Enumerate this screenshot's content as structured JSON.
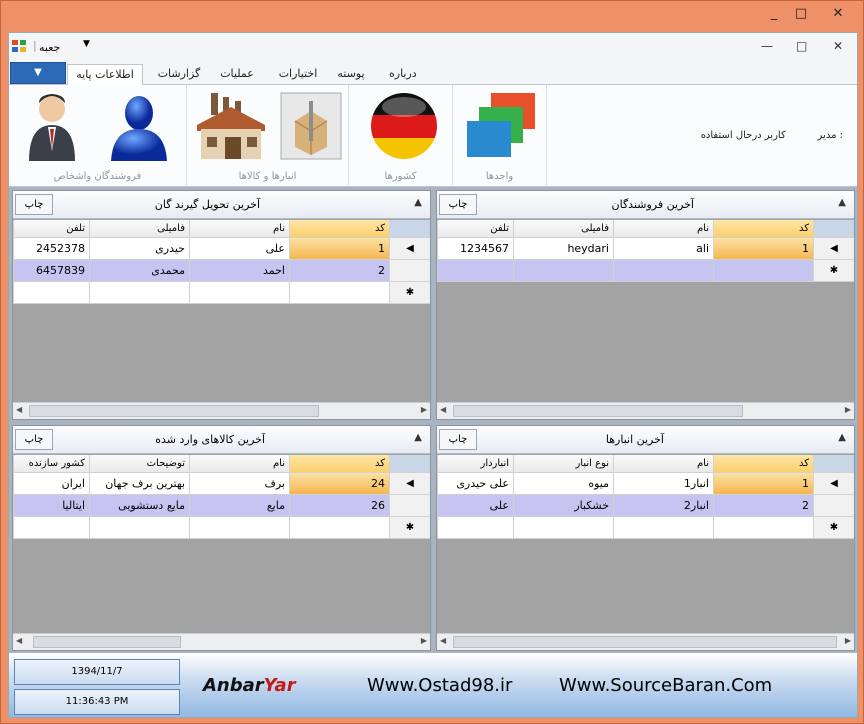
{
  "window": {
    "minimize": "_",
    "maximize": "□",
    "close": "✕"
  },
  "qat": {
    "title": "جعبه",
    "dropdown": "▼",
    "minimize": "—",
    "restore": "□",
    "close": "✕"
  },
  "tabs": {
    "file": "▼",
    "items": [
      "اطلاعات پایه",
      "گزارشات",
      "عملیات",
      "اختیارات",
      "پوسته",
      "درباره"
    ]
  },
  "ribbon": {
    "groups": [
      {
        "label": "واحدها",
        "icon": "layers-icon"
      },
      {
        "label": "کشورها",
        "icon": "germany-flag-icon"
      },
      {
        "label": "انبارها و کالاها",
        "icon": "warehouse-icon"
      },
      {
        "label": "فروشندگان واشخاص",
        "icon": "users-icon"
      }
    ],
    "user_label": "کاربر درحال استفاده :",
    "user_value": "مدیر"
  },
  "panels": {
    "suppliers": {
      "title": "آخرین فروشندگان",
      "print": "چاپ",
      "collapse": "«",
      "columns": [
        "کد",
        "نام",
        "فامیلی",
        "تلفن"
      ],
      "rows": [
        [
          "1",
          "ali",
          "heydari",
          "1234567"
        ]
      ]
    },
    "receivers": {
      "title": "آخرین تحویل گیرند گان",
      "print": "چاپ",
      "collapse": "«",
      "columns": [
        "کد",
        "نام",
        "فامیلی",
        "تلفن"
      ],
      "rows": [
        [
          "1",
          "علی",
          "حیدری",
          "2452378"
        ],
        [
          "2",
          "احمد",
          "محمدی",
          "6457839"
        ]
      ]
    },
    "warehouses": {
      "title": "آخرین انبارها",
      "print": "چاپ",
      "collapse": "«",
      "columns": [
        "کد",
        "نام",
        "نوع انبار",
        "انباردار"
      ],
      "rows": [
        [
          "1",
          "انبار1",
          "میوه",
          "علی حیدری"
        ],
        [
          "2",
          "انبار2",
          "خشکبار",
          "علی"
        ]
      ]
    },
    "goods": {
      "title": "آخرین کالاهای وارد شده",
      "print": "چاپ",
      "collapse": "«",
      "columns": [
        "کد",
        "نام",
        "توضیحات",
        "کشور سازنده"
      ],
      "rows": [
        [
          "24",
          "برف",
          "بهترین برف جهان",
          "ایران"
        ],
        [
          "26",
          "مایع",
          "مایع دستشویی",
          "ایتالیا"
        ]
      ]
    }
  },
  "footer": {
    "date": "1394/11/7",
    "time": "11:36:43 PM",
    "brand_a": "Anbar",
    "brand_b": "Yar",
    "site1": "Www.Ostad98.ir",
    "site2": "Www.SourceBaran.Com"
  },
  "colors": {
    "accent": "#2a6ab7",
    "selected_cell": "#f6b54f",
    "alt_row": "#c6c5f2"
  }
}
